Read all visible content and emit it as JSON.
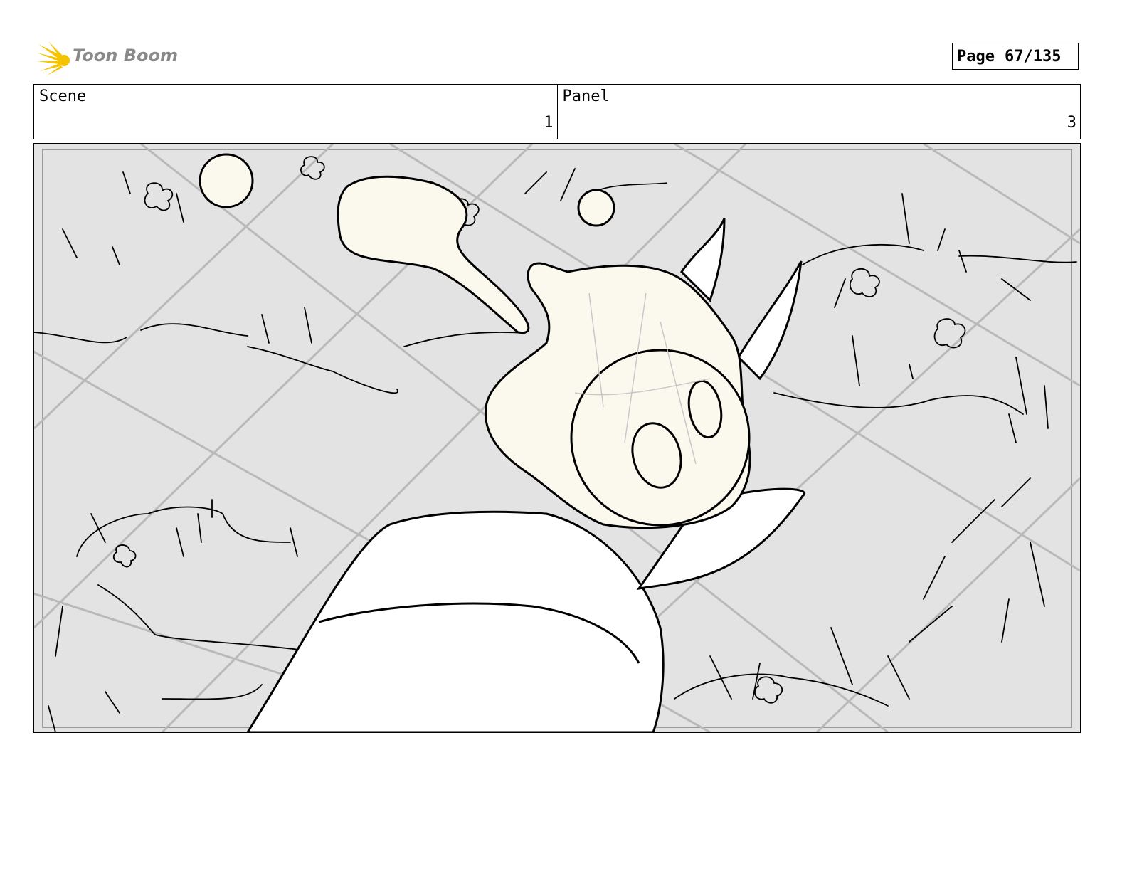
{
  "brand": {
    "logo_text": "Toon Boom",
    "logo_color": "#f5c400",
    "text_color": "#8a8a8a"
  },
  "page": {
    "label": "Page",
    "value": "67/135"
  },
  "scene": {
    "label": "Scene",
    "value": "1"
  },
  "panel": {
    "label": "Panel",
    "value": "3"
  },
  "colors": {
    "ground": "#e3e3e3",
    "lines": "#b9b9b9",
    "ghost": "#fbf9ee",
    "ink": "#000000"
  }
}
